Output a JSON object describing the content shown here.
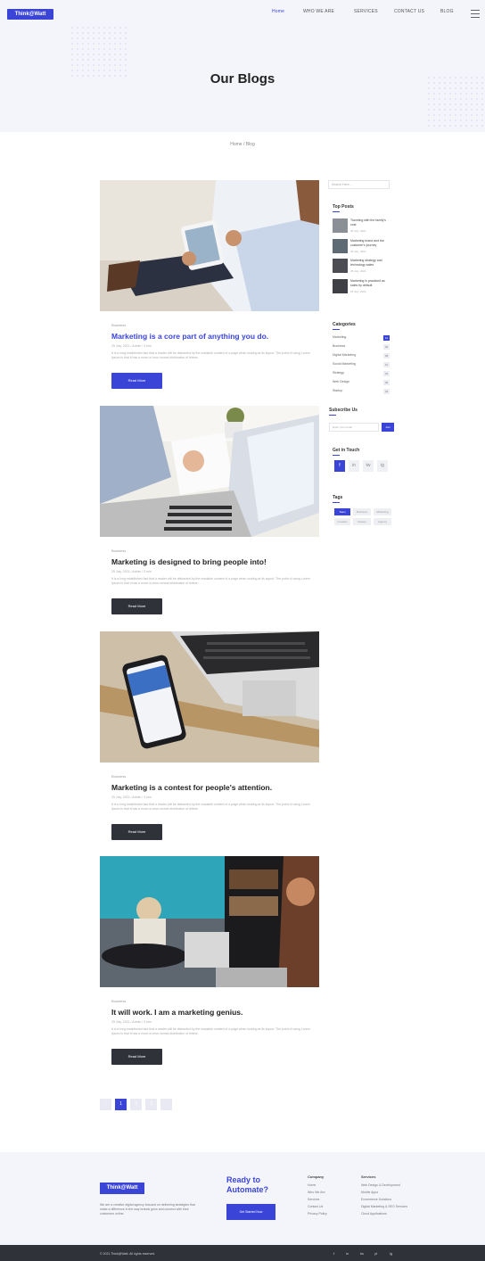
{
  "header": {
    "logo": "Think@Watt",
    "nav": [
      "Home",
      "WHO WE ARE",
      "SERVICES",
      "CONTACT US",
      "BLOG"
    ],
    "title": "Our Blogs",
    "breadcrumb": "Home / Blog"
  },
  "posts": [
    {
      "category": "Business",
      "title": "Marketing is a core part of anything you do.",
      "meta": "25 July, 2021  /  Admin / 3 min",
      "excerpt": "It is a long established fact that a reader will be distracted by the readable content of a page when looking at its layout. The point of using Lorem Ipsum is that it has a more-or-less normal distribution of letters.",
      "button": "Read More",
      "title_color": "#3a45d8"
    },
    {
      "category": "Business",
      "title": "Marketing is designed to bring people into!",
      "meta": "25 July, 2021  /  Admin / 3 min",
      "excerpt": "It is a long established fact that a reader will be distracted by the readable content of a page when looking at its layout. The point of using Lorem Ipsum is that it has a more-or-less normal distribution of letters.",
      "button": "Read More",
      "title_color": "#222222"
    },
    {
      "category": "Business",
      "title": "Marketing is a contest for people's attention.",
      "meta": "25 July, 2021  /  Admin / 3 min",
      "excerpt": "It is a long established fact that a reader will be distracted by the readable content of a page when looking at its layout. The point of using Lorem Ipsum is that it has a more-or-less normal distribution of letters.",
      "button": "Read More",
      "title_color": "#222222"
    },
    {
      "category": "Business",
      "title": "It will work. I am a marketing genius.",
      "meta": "25 July, 2021  /  Admin / 3 min",
      "excerpt": "It is a long established fact that a reader will be distracted by the readable content of a page when looking at its layout. The point of using Lorem Ipsum is that it has a more-or-less normal distribution of letters.",
      "button": "Read More",
      "title_color": "#222222"
    }
  ],
  "sidebar": {
    "search_placeholder": "Search Here...",
    "top_posts_heading": "Top Posts",
    "top_posts": [
      {
        "title": "Traveling with the family's cost",
        "date": "25 July, 2021"
      },
      {
        "title": "Marketing brand and the customer's journey",
        "date": "25 July, 2021"
      },
      {
        "title": "Marketing strategy and technology sales",
        "date": "25 July, 2021"
      },
      {
        "title": "Marketing is practiced as sales by default",
        "date": "25 July, 2021"
      }
    ],
    "categories_heading": "Categories",
    "categories": [
      {
        "name": "Marketing",
        "count": "12"
      },
      {
        "name": "Business",
        "count": "06"
      },
      {
        "name": "Digital Marketing",
        "count": "08"
      },
      {
        "name": "Social Marketing",
        "count": "10"
      },
      {
        "name": "Strategy",
        "count": "04"
      },
      {
        "name": "Web Design",
        "count": "05"
      },
      {
        "name": "Startup",
        "count": "03"
      }
    ],
    "subscribe_heading": "Subscribe Us",
    "subscribe_placeholder": "Enter your email",
    "subscribe_button": "Join",
    "social_heading": "Get in Touch",
    "social": [
      "f",
      "in",
      "tw",
      "ig"
    ],
    "tags_heading": "Tags",
    "tags": [
      "Team",
      "Business",
      "Marketing",
      "Creative",
      "Design",
      "Agency"
    ]
  },
  "pagination": [
    "‹",
    "1",
    "2",
    "3",
    "›"
  ],
  "footer": {
    "logo": "Think@Watt",
    "about": "We are a creative digital agency focused on delivering strategies that make a difference in the way brands grow and connect with their customers online.",
    "ready_title": "Ready to Automate?",
    "cta_button": "Get Started Now",
    "col1_head": "Company",
    "col1_links": [
      "Home",
      "Who We Are",
      "Services",
      "Contact Us",
      "Privacy Policy"
    ],
    "col2_head": "Services",
    "col2_links": [
      "Web Design & Development",
      "Mobile Apps",
      "Ecommerce Solutions",
      "Digital Marketing & SEO Services",
      "Cloud Applications"
    ],
    "copyright": "© 2021 Think@Watt. All rights reserved.",
    "bottom_social": [
      "f",
      "in",
      "tw",
      "yt",
      "ig"
    ]
  },
  "colors": {
    "accent": "#3a45d8",
    "dark": "#30323a",
    "hero_bg": "#f4f5fa"
  }
}
